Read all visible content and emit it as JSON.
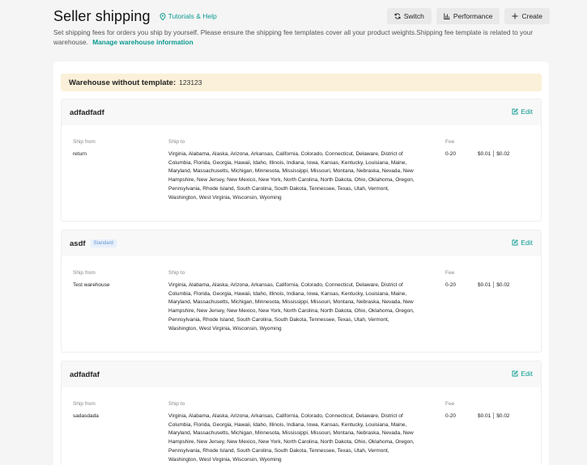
{
  "header": {
    "title": "Seller shipping",
    "help_label": "Tutorials & Help",
    "buttons": {
      "switch": "Switch",
      "performance": "Performance",
      "create": "Create"
    },
    "description": "Set shipping fees for orders you ship by yourself. Please ensure the shipping fee templates cover all your product weights.Shipping fee template is related to your warehouse.",
    "manage_link": "Manage warehouse information"
  },
  "banner": {
    "label": "Warehouse without template:",
    "value": "123123"
  },
  "columns": {
    "ship_from": "Ship from",
    "ship_to": "Ship to",
    "fee": "Fee"
  },
  "edit_label": "Edit",
  "templates": [
    {
      "name": "adfadfadf",
      "badge": "",
      "ship_from": "return",
      "ship_to": "Virginia, Alabama, Alaska, Arizona, Arkansas, California, Colorado, Connecticut, Delaware, District of Columbia, Florida, Georgia, Hawaii, Idaho, Illinois, Indiana, Iowa, Kansas, Kentucky, Louisiana, Maine, Maryland, Massachusetts, Michigan, Minnesota, Mississippi, Missouri, Montana, Nebraska, Nevada, New Hampshire, New Jersey, New Mexico, New York, North Carolina, North Dakota, Ohio, Oklahoma, Oregon, Pennsylvania, Rhode Island, South Carolina, South Dakota, Tennessee, Texas, Utah, Vermont, Washington, West Virginia, Wisconsin, Wyoming",
      "fee_range": "0-20",
      "fee_first": "$0.01",
      "fee_additional": "$0.02"
    },
    {
      "name": "asdf",
      "badge": "Standard",
      "ship_from": "Test warehouse",
      "ship_to": "Virginia, Alabama, Alaska, Arizona, Arkansas, California, Colorado, Connecticut, Delaware, District of Columbia, Florida, Georgia, Hawaii, Idaho, Illinois, Indiana, Iowa, Kansas, Kentucky, Louisiana, Maine, Maryland, Massachusetts, Michigan, Minnesota, Mississippi, Missouri, Montana, Nebraska, Nevada, New Hampshire, New Jersey, New Mexico, New York, North Carolina, North Dakota, Ohio, Oklahoma, Oregon, Pennsylvania, Rhode Island, South Carolina, South Dakota, Tennessee, Texas, Utah, Vermont, Washington, West Virginia, Wisconsin, Wyoming",
      "fee_range": "0-20",
      "fee_first": "$0.01",
      "fee_additional": "$0.02"
    },
    {
      "name": "adfadfaf",
      "badge": "",
      "ship_from": "sadasdada",
      "ship_to": "Virginia, Alabama, Alaska, Arizona, Arkansas, California, Colorado, Connecticut, Delaware, District of Columbia, Florida, Georgia, Hawaii, Idaho, Illinois, Indiana, Iowa, Kansas, Kentucky, Louisiana, Maine, Maryland, Massachusetts, Michigan, Minnesota, Mississippi, Missouri, Montana, Nebraska, Nevada, New Hampshire, New Jersey, New Mexico, New York, North Carolina, North Dakota, Ohio, Oklahoma, Oregon, Pennsylvania, Rhode Island, South Carolina, South Dakota, Tennessee, Texas, Utah, Vermont, Washington, West Virginia, Wisconsin, Wyoming",
      "fee_range": "0-20",
      "fee_first": "$0.01",
      "fee_additional": "$0.02"
    }
  ],
  "icons": {
    "help": "location-pin-icon",
    "switch": "refresh-icon",
    "performance": "bar-chart-icon",
    "create": "plus-icon",
    "edit": "edit-icon"
  },
  "colors": {
    "accent": "#0b9a8f",
    "banner_bg": "#fbf0d9",
    "badge_bg": "#e6f0fb",
    "badge_text": "#6c95cf"
  }
}
